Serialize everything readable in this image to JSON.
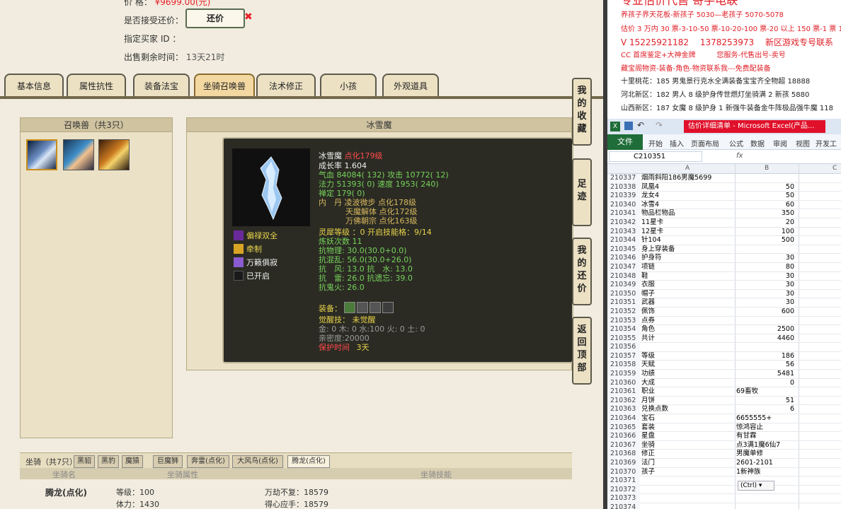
{
  "left": {
    "price_label": "价 格：",
    "price_value": "¥9699.00(元)",
    "accept_bargain_label": "是否接受还价：",
    "bargain_button": "还价",
    "bargain_mark": "✖",
    "buyer_label": "指定买家 ID ：",
    "remaining_label": "出售剩余时间：",
    "remaining_value": "13天21时",
    "tabs": [
      "基本信息",
      "属性抗性",
      "装备法宝",
      "坐骑召唤兽",
      "法术修正",
      "小孩",
      "外观道具"
    ],
    "summon_panel_title": "召唤兽（共3只）",
    "detail_title": "冰雪魔",
    "side_buttons": [
      [
        "我",
        "的",
        "收",
        "藏"
      ],
      [
        "足",
        "迹"
      ],
      [
        "我",
        "的",
        "还",
        "价"
      ],
      [
        "返",
        "回",
        "顶",
        "部"
      ]
    ],
    "pet": {
      "name": "冰雪魔",
      "rank": "点化179级",
      "growth": "成长率 1.604",
      "hp": "气血 84084( 132)",
      "attack": "攻击 10772( 12)",
      "mana": "法力 51393( 0)",
      "speed": "速度 1953( 240)",
      "focus": "禅定 179( 0)",
      "pill_label": "内　丹",
      "pills": [
        "凌波微步 点化178级",
        "天魔解体 点化172级",
        "万佛朝宗 点化163级"
      ],
      "soul_level": "灵犀等级 ：0 开启技能格：9/14",
      "refine": "炼妖次数 11",
      "res": [
        "抗物理: 30.0(30.0+0.0)",
        "抗混乱: 56.0(30.0+26.0)",
        "抗　风: 13.0 抗　水: 13.0",
        "抗　雷: 26.0 抗遗忘: 39.0",
        "抗鬼火: 26.0"
      ],
      "equip_label": "装备：",
      "awaken": "觉醒技： 未觉醒",
      "elements": "金: 0 木: 0 水:100 火: 0 土: 0",
      "intimacy": "亲密度:20000",
      "protect_label": "保护时间",
      "protect_value": "3天",
      "skills": [
        "偏禄双全",
        "牵制",
        "万籁俱寂",
        "已开启"
      ]
    },
    "mount_tabs": [
      "坐骑（共7只）",
      "黑貂",
      "黑豹",
      "魔猿",
      "巨魔狮",
      "奔雷(点化)",
      "大风鸟(点化)",
      "腾龙(点化)"
    ],
    "mount_head": [
      "坐骑名",
      "坐骑属性",
      "坐骑技能"
    ],
    "mount_row": {
      "name": "腾龙(点化)",
      "level": "等级：100",
      "stamina": "体力：1430",
      "skill1": "万劫不复：18579",
      "skill2": "得心应手：18579"
    }
  },
  "doc": {
    "lines": [
      "专业估价代售 寄手电联",
      "养孩子界天花板-新孩子 5030—老孩子 5070-5078",
      "估价 3 万内 30 票-3-10-50 票-10-20-100 票-20 以上 150 票-1 票 1",
      "V 15225921182 　1378253973 　新区游戏专号联系",
      "CC 首席鉴定+大神金牌　　　您服务-代售出号-卖号",
      "藏宝阁物资-装备-角色-物资联系我---免费配装备",
      "十里桃花：185 男鬼景行克水全满装备宝宝齐全物超 18888",
      "河北新区：182 男人 8 级护身传世燃灯坐骑满 2 新孩 5880",
      "山西新区：187 女魔 8 级护身 1 新强牛装备金牛阵极品强牛魔 118"
    ]
  },
  "excel": {
    "window_title": "估价详细清单 - Microsoft Excel(产品...",
    "file_tab": "文件",
    "ribbon": [
      "开始",
      "插入",
      "页面布局",
      "公式",
      "数据",
      "审阅",
      "视图",
      "开发工具"
    ],
    "name_box": "C210351",
    "fx": "fx",
    "cols": [
      "A",
      "B",
      "C"
    ],
    "rows": [
      [
        "210337",
        "烟雨斜阳186男魔5699",
        ""
      ],
      [
        "210338",
        "凤凰4",
        "50"
      ],
      [
        "210339",
        "龙女4",
        "50"
      ],
      [
        "210340",
        "冰雪4",
        "60"
      ],
      [
        "210341",
        "物品栏物品",
        "350"
      ],
      [
        "210342",
        "11星卡",
        "20"
      ],
      [
        "210343",
        "12星卡",
        "100"
      ],
      [
        "210344",
        "针104",
        "500"
      ],
      [
        "210345",
        "身上穿装备",
        ""
      ],
      [
        "210346",
        "护身符",
        "30"
      ],
      [
        "210347",
        "项链",
        "80"
      ],
      [
        "210348",
        "鞋",
        "30"
      ],
      [
        "210349",
        "衣服",
        "30"
      ],
      [
        "210350",
        "帽子",
        "30"
      ],
      [
        "210351",
        "武器",
        "30"
      ],
      [
        "210352",
        "佩饰",
        "600"
      ],
      [
        "210353",
        "点券",
        ""
      ],
      [
        "210354",
        "角色",
        "2500"
      ],
      [
        "210355",
        "共计",
        "4460"
      ],
      [
        "210356",
        "",
        ""
      ],
      [
        "210357",
        "等级",
        "186"
      ],
      [
        "210358",
        "天赋",
        "56"
      ],
      [
        "210359",
        "功绩",
        "5481"
      ],
      [
        "210360",
        "大成",
        "0"
      ],
      [
        "210361",
        "职业",
        "69畜牧"
      ],
      [
        "210362",
        "月饼",
        "51"
      ],
      [
        "210363",
        "兑换点数",
        "6"
      ],
      [
        "210364",
        "宝石",
        "6655555+"
      ],
      [
        "210365",
        "套装",
        "惊鸿容止"
      ],
      [
        "210366",
        "星盘",
        "有甘霖"
      ],
      [
        "210367",
        "坐骑",
        "点3满1魔6仙7"
      ],
      [
        "210368",
        "修正",
        "男魔单修"
      ],
      [
        "210369",
        "法门",
        "2601-2101"
      ],
      [
        "210370",
        "孩子",
        "1新神族"
      ],
      [
        "210371",
        "",
        ""
      ],
      [
        "210372",
        "",
        ""
      ],
      [
        "210373",
        "",
        ""
      ],
      [
        "210374",
        "",
        ""
      ]
    ],
    "paste_hint": "(Ctrl) ▾"
  }
}
